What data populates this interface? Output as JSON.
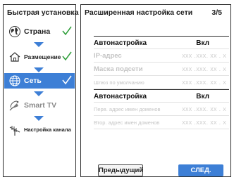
{
  "sidebar": {
    "title": "Быстрая установка",
    "steps": [
      {
        "label": "Страна",
        "icon": "globe-icon",
        "done": true
      },
      {
        "label": "Размещение",
        "icon": "house-icon",
        "done": true
      },
      {
        "label": "Сеть",
        "icon": "network-globe-icon",
        "done": true,
        "active": true
      },
      {
        "label": "Smart TV",
        "icon": "satellite-icon",
        "done": false
      },
      {
        "label": "Настройка канала",
        "icon": "antenna-icon",
        "done": false
      }
    ]
  },
  "main": {
    "title": "Расширенная настройка сети",
    "page": "3/5",
    "rows": [
      {
        "label": "Автонастройка",
        "value": "Вкл"
      },
      {
        "label": "IP-адрес",
        "value": "xxx .xxx. xx . x"
      },
      {
        "label": "Маска подсети",
        "value": "xxx .xxx. xx . x"
      },
      {
        "label": "Шлюз по умолчанию",
        "value": "xxx .xxx. xx . x"
      },
      {
        "label": "Автонастройка",
        "value": "Вкл"
      },
      {
        "label": "Перв. адрес имен доменов",
        "value": "xxx .xxx. xx . x"
      },
      {
        "label": "Втор. адрес имен доменов",
        "value": "xxx .xxx. xx . x"
      }
    ],
    "prev_label": "Предыдущий",
    "next_label": "СЛЕД."
  },
  "colors": {
    "accent": "#3d7fd6",
    "check": "#2e9e3a",
    "disabled_text": "#c4c4c4"
  }
}
